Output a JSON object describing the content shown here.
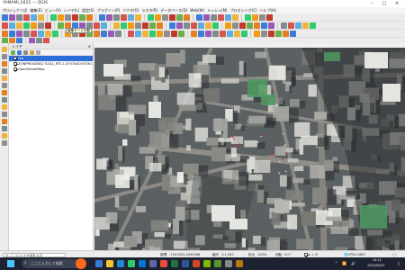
{
  "window": {
    "title": "YAMAMI_0425 — QGIS"
  },
  "menu": [
    "プロジェクト(J)",
    "編集(E)",
    "ビュー(V)",
    "レイヤ(L)",
    "設定(S)",
    "プラグイン(P)",
    "ベクタ(O)",
    "ラスタ(R)",
    "データベース(D)",
    "Web(W)",
    "メッシュ(M)",
    "プロセシング(C)",
    "ヘルプ(H)"
  ],
  "tooltip": "編集モード切替",
  "layers_panel": {
    "title": "レイヤ",
    "items": [
      {
        "label": "Ort",
        "checked": true,
        "selected": true
      },
      {
        "label": "ZONPR04DN02 S2A1_RTC1-0707A0047530...",
        "checked": true,
        "selected": false
      },
      {
        "label": "OpenStreetMap",
        "checked": true,
        "selected": false
      }
    ]
  },
  "status": {
    "locator": "Q. ここにレイヤ名を入力",
    "coord_label": "座標",
    "coord": "-7521541,4434398",
    "scale_label": "縮尺",
    "scale": "1:1,547",
    "magnifier_label": "拡大",
    "magnifier": "100%",
    "rotation_label": "回転",
    "rotation": "0.0 °",
    "render": "レンダ",
    "crs": "EPSG:3857"
  },
  "taskbar": {
    "search_placeholder": "ここに入力して検索",
    "time": "10:12",
    "date": "2024/04/25"
  },
  "colors": {
    "selection": "#2b6ed9",
    "taskbar": "#1c2230",
    "map_base": "#5d6263"
  }
}
